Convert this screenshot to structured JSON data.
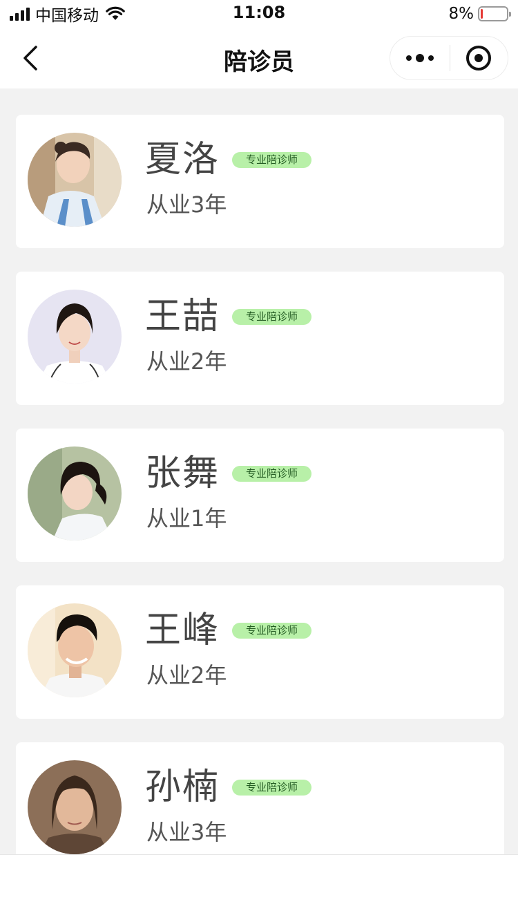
{
  "status_bar": {
    "carrier": "中国移动",
    "time": "11:08",
    "battery": "8%",
    "battery_level": 0.08,
    "icons": [
      "signal-icon",
      "wifi-icon",
      "battery-icon"
    ]
  },
  "nav": {
    "title": "陪诊员",
    "icons": [
      "back-arrow-icon",
      "more-dots-icon",
      "close-target-icon"
    ]
  },
  "escorts": [
    {
      "name": "夏洛",
      "badge": "专业陪诊师",
      "experience": "从业3年"
    },
    {
      "name": "王喆",
      "badge": "专业陪诊师",
      "experience": "从业2年"
    },
    {
      "name": "张舞",
      "badge": "专业陪诊师",
      "experience": "从业1年"
    },
    {
      "name": "王峰",
      "badge": "专业陪诊师",
      "experience": "从业2年"
    },
    {
      "name": "孙楠",
      "badge": "专业陪诊师",
      "experience": "从业3年"
    }
  ],
  "colors": {
    "page_background": "#f2f2f2",
    "card_background": "#ffffff",
    "badge_background": "#b8f0a8",
    "badge_text": "#245c23",
    "battery_low": "#e53935"
  }
}
